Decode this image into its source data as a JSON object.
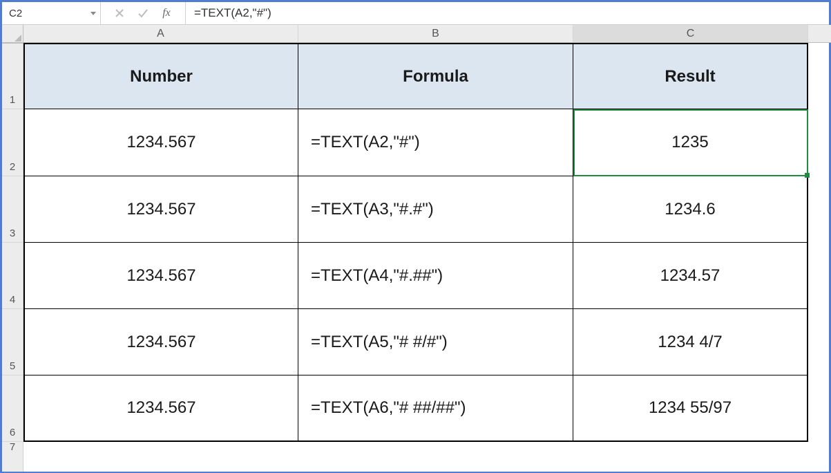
{
  "formula_bar": {
    "name_box": "C2",
    "fx_label": "fx",
    "formula": "=TEXT(A2,\"#\")"
  },
  "columns": {
    "A": "A",
    "B": "B",
    "C": "C"
  },
  "row_numbers": [
    "1",
    "2",
    "3",
    "4",
    "5",
    "6",
    "7"
  ],
  "table": {
    "headers": {
      "A": "Number",
      "B": "Formula",
      "C": "Result"
    },
    "rows": [
      {
        "number": "1234.567",
        "formula": "=TEXT(A2,\"#\")",
        "result": "1235"
      },
      {
        "number": "1234.567",
        "formula": "=TEXT(A3,\"#.#\")",
        "result": "1234.6"
      },
      {
        "number": "1234.567",
        "formula": "=TEXT(A4,\"#.##\")",
        "result": "1234.57"
      },
      {
        "number": "1234.567",
        "formula": "=TEXT(A5,\"# #/#\")",
        "result": "1234 4/7"
      },
      {
        "number": "1234.567",
        "formula": "=TEXT(A6,\"# ##/##\")",
        "result": "1234 55/97"
      }
    ]
  },
  "active_cell": "C2"
}
